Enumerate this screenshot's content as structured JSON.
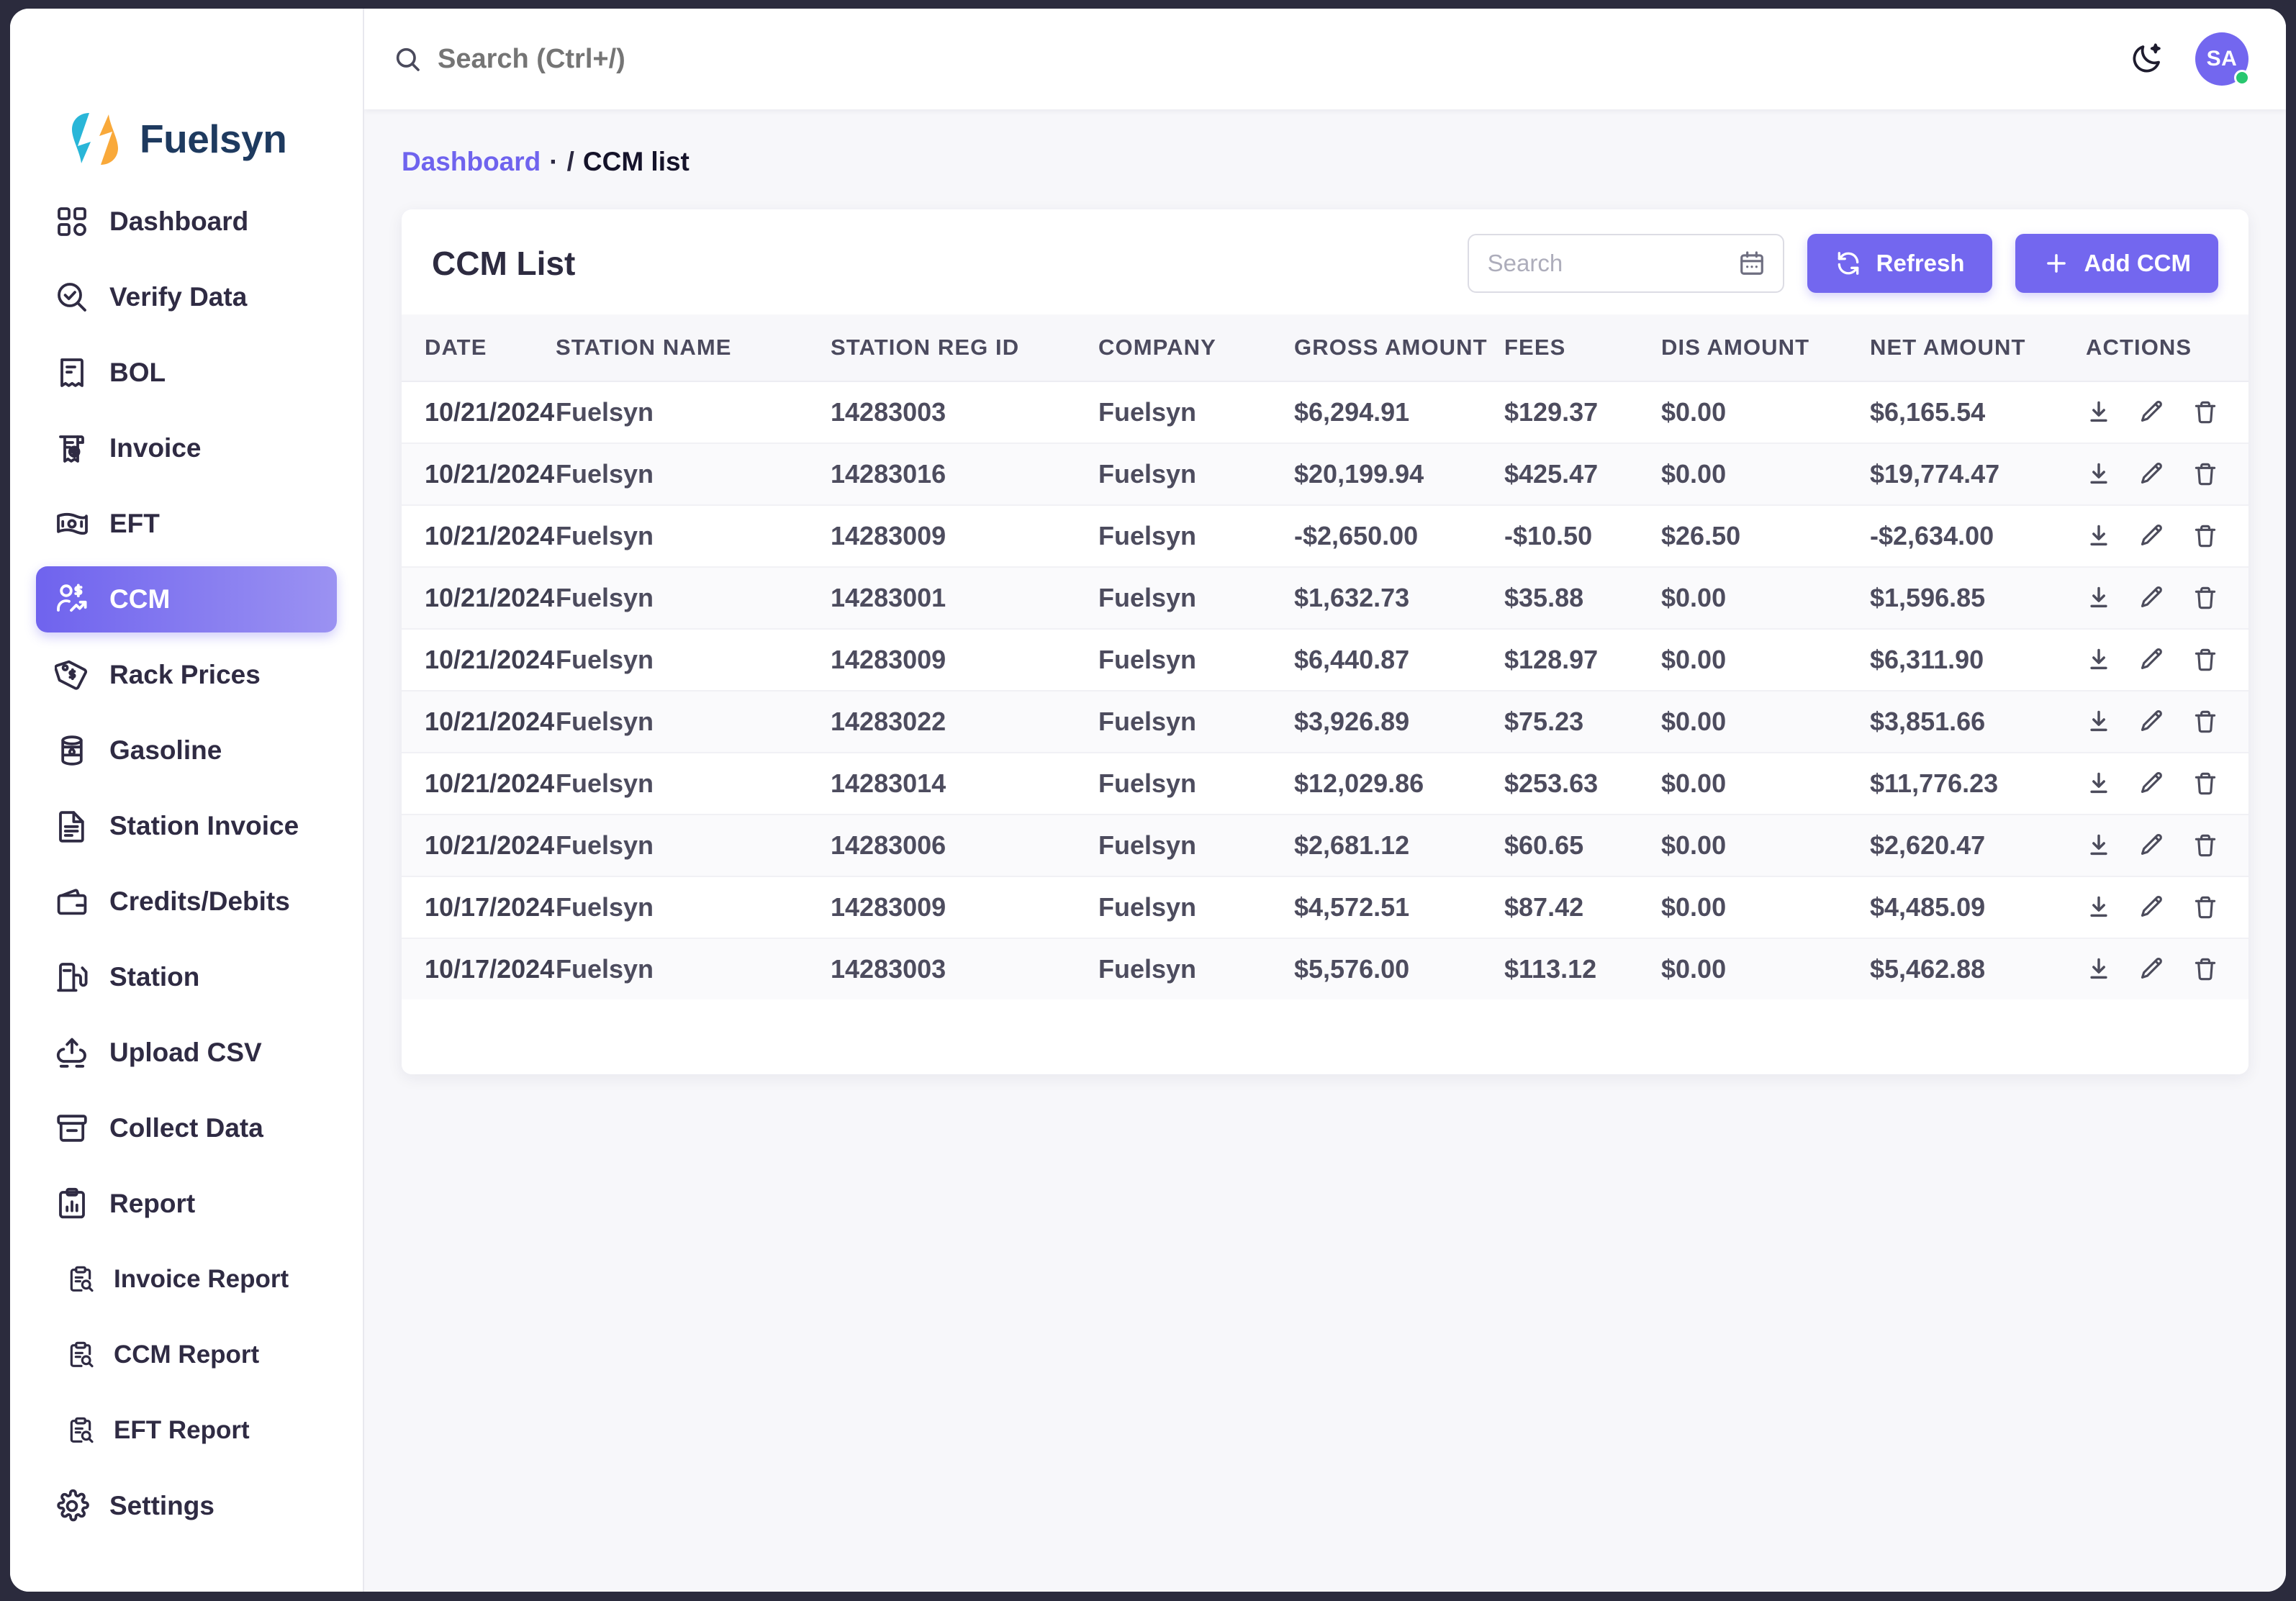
{
  "brand": {
    "name": "Fuelsyn"
  },
  "sidebar": {
    "items": [
      {
        "label": "Dashboard",
        "icon": "grid-icon",
        "active": false,
        "sub": false
      },
      {
        "label": "Verify Data",
        "icon": "search-check-icon",
        "active": false,
        "sub": false
      },
      {
        "label": "BOL",
        "icon": "receipt-icon",
        "active": false,
        "sub": false
      },
      {
        "label": "Invoice",
        "icon": "receipt-dollar-icon",
        "active": false,
        "sub": false
      },
      {
        "label": "EFT",
        "icon": "banknote-icon",
        "active": false,
        "sub": false
      },
      {
        "label": "CCM",
        "icon": "user-dollar-chart-icon",
        "active": true,
        "sub": false
      },
      {
        "label": "Rack Prices",
        "icon": "price-tag-icon",
        "active": false,
        "sub": false
      },
      {
        "label": "Gasoline",
        "icon": "oil-barrel-icon",
        "active": false,
        "sub": false
      },
      {
        "label": "Station Invoice",
        "icon": "document-lines-icon",
        "active": false,
        "sub": false
      },
      {
        "label": "Credits/Debits",
        "icon": "wallet-icon",
        "active": false,
        "sub": false
      },
      {
        "label": "Station",
        "icon": "fuel-pump-icon",
        "active": false,
        "sub": false
      },
      {
        "label": "Upload CSV",
        "icon": "upload-icon",
        "active": false,
        "sub": false
      },
      {
        "label": "Collect Data",
        "icon": "archive-box-icon",
        "active": false,
        "sub": false
      },
      {
        "label": "Report",
        "icon": "clipboard-chart-icon",
        "active": false,
        "sub": false
      },
      {
        "label": "Invoice Report",
        "icon": "clipboard-search-icon",
        "active": false,
        "sub": true
      },
      {
        "label": "CCM Report",
        "icon": "clipboard-search-icon",
        "active": false,
        "sub": true
      },
      {
        "label": "EFT Report",
        "icon": "clipboard-search-icon",
        "active": false,
        "sub": true
      },
      {
        "label": "Settings",
        "icon": "gear-icon",
        "active": false,
        "sub": false
      }
    ]
  },
  "topbar": {
    "search_placeholder": "Search (Ctrl+/)",
    "search_value": "",
    "theme_toggle_icon": "moon-icon",
    "avatar_initials": "SA",
    "status_color": "#28c76f"
  },
  "breadcrumb": {
    "root": "Dashboard",
    "dot": "·",
    "separator": "/",
    "current": "CCM list"
  },
  "card": {
    "title": "CCM List",
    "search_placeholder": "Search",
    "search_value": "",
    "calendar_icon": "calendar-icon",
    "refresh_label": "Refresh",
    "refresh_icon": "refresh-icon",
    "add_label": "Add CCM",
    "add_icon": "plus-icon",
    "accent_color": "#7367ef"
  },
  "table": {
    "columns": [
      "DATE",
      "STATION NAME",
      "STATION REG ID",
      "COMPANY",
      "GROSS AMOUNT",
      "FEES",
      "DIS AMOUNT",
      "NET AMOUNT",
      "ACTIONS"
    ],
    "row_actions": [
      "download-icon",
      "edit-icon",
      "delete-icon"
    ],
    "rows": [
      {
        "date": "10/21/2024",
        "station_name": "Fuelsyn",
        "station_reg_id": "14283003",
        "company": "Fuelsyn",
        "gross_amount": "$6,294.91",
        "fees": "$129.37",
        "dis_amount": "$0.00",
        "net_amount": "$6,165.54"
      },
      {
        "date": "10/21/2024",
        "station_name": "Fuelsyn",
        "station_reg_id": "14283016",
        "company": "Fuelsyn",
        "gross_amount": "$20,199.94",
        "fees": "$425.47",
        "dis_amount": "$0.00",
        "net_amount": "$19,774.47"
      },
      {
        "date": "10/21/2024",
        "station_name": "Fuelsyn",
        "station_reg_id": "14283009",
        "company": "Fuelsyn",
        "gross_amount": "-$2,650.00",
        "fees": "-$10.50",
        "dis_amount": "$26.50",
        "net_amount": "-$2,634.00"
      },
      {
        "date": "10/21/2024",
        "station_name": "Fuelsyn",
        "station_reg_id": "14283001",
        "company": "Fuelsyn",
        "gross_amount": "$1,632.73",
        "fees": "$35.88",
        "dis_amount": "$0.00",
        "net_amount": "$1,596.85"
      },
      {
        "date": "10/21/2024",
        "station_name": "Fuelsyn",
        "station_reg_id": "14283009",
        "company": "Fuelsyn",
        "gross_amount": "$6,440.87",
        "fees": "$128.97",
        "dis_amount": "$0.00",
        "net_amount": "$6,311.90"
      },
      {
        "date": "10/21/2024",
        "station_name": "Fuelsyn",
        "station_reg_id": "14283022",
        "company": "Fuelsyn",
        "gross_amount": "$3,926.89",
        "fees": "$75.23",
        "dis_amount": "$0.00",
        "net_amount": "$3,851.66"
      },
      {
        "date": "10/21/2024",
        "station_name": "Fuelsyn",
        "station_reg_id": "14283014",
        "company": "Fuelsyn",
        "gross_amount": "$12,029.86",
        "fees": "$253.63",
        "dis_amount": "$0.00",
        "net_amount": "$11,776.23"
      },
      {
        "date": "10/21/2024",
        "station_name": "Fuelsyn",
        "station_reg_id": "14283006",
        "company": "Fuelsyn",
        "gross_amount": "$2,681.12",
        "fees": "$60.65",
        "dis_amount": "$0.00",
        "net_amount": "$2,620.47"
      },
      {
        "date": "10/17/2024",
        "station_name": "Fuelsyn",
        "station_reg_id": "14283009",
        "company": "Fuelsyn",
        "gross_amount": "$4,572.51",
        "fees": "$87.42",
        "dis_amount": "$0.00",
        "net_amount": "$4,485.09"
      },
      {
        "date": "10/17/2024",
        "station_name": "Fuelsyn",
        "station_reg_id": "14283003",
        "company": "Fuelsyn",
        "gross_amount": "$5,576.00",
        "fees": "$113.12",
        "dis_amount": "$0.00",
        "net_amount": "$5,462.88"
      }
    ]
  }
}
